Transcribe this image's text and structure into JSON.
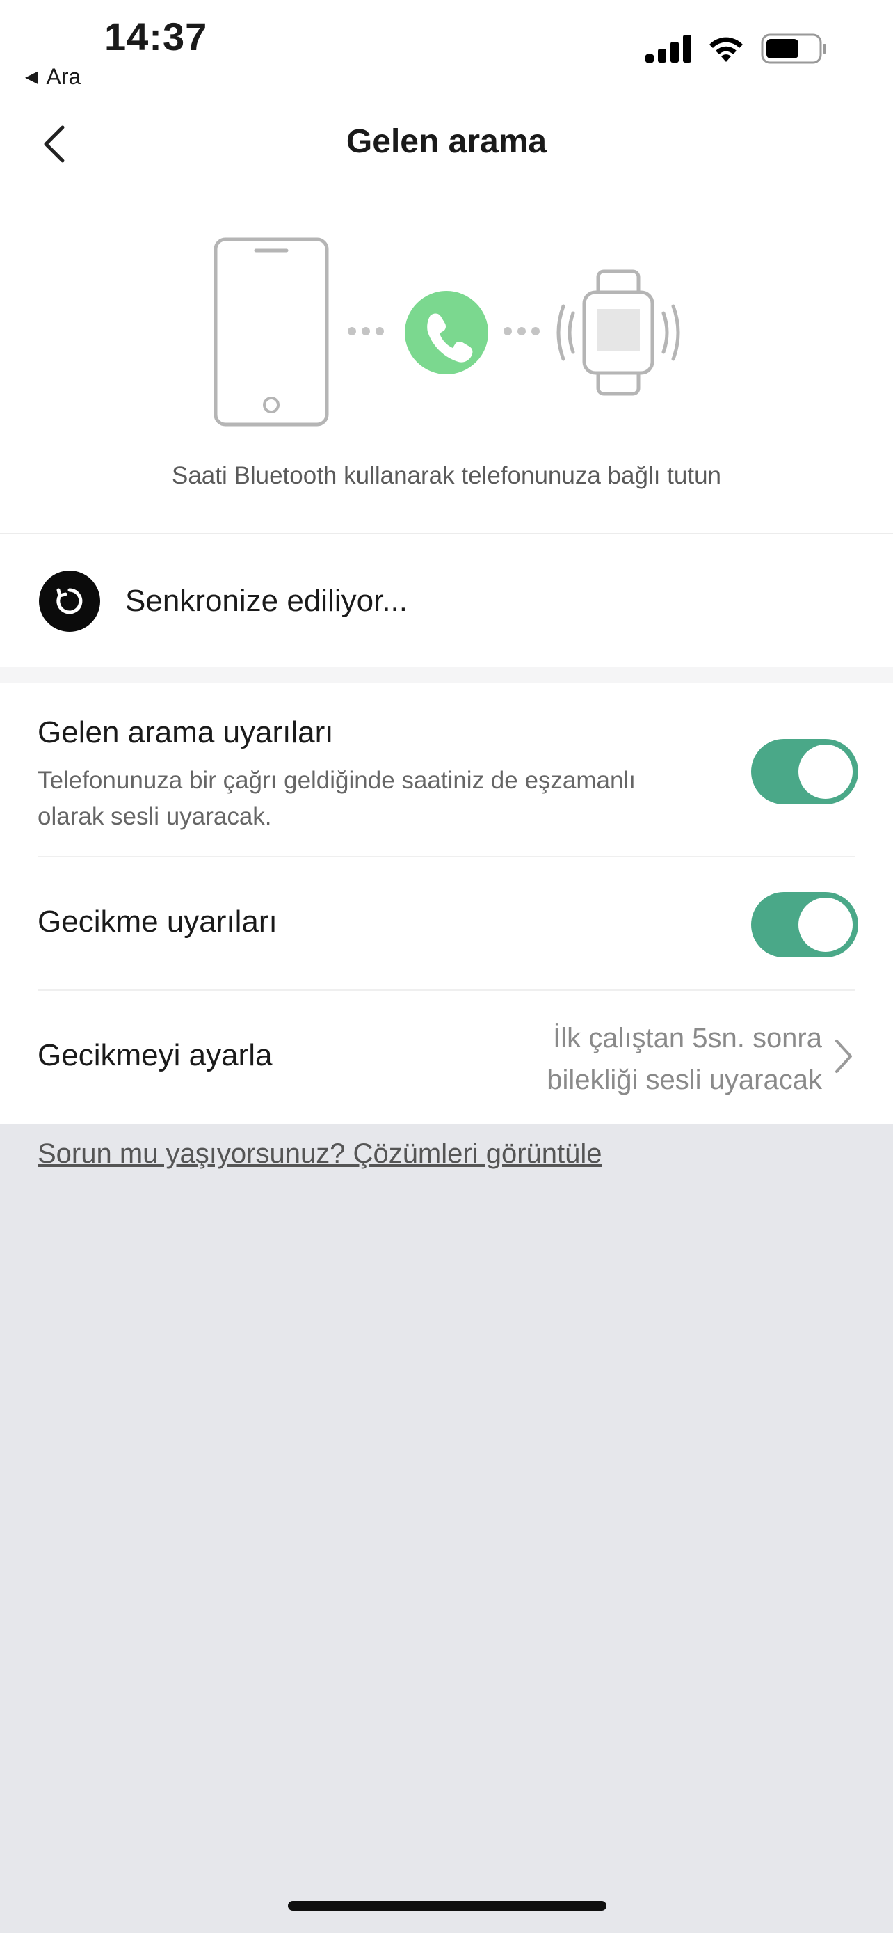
{
  "status_bar": {
    "time": "14:37",
    "back_app": "Ara",
    "icons": [
      "signal-icon",
      "wifi-icon",
      "battery-icon"
    ]
  },
  "nav": {
    "title": "Gelen arama",
    "back_icon": "chevron-left-icon"
  },
  "illustration": {
    "caption": "Saati Bluetooth kullanarak telefonunuza bağlı tutun",
    "icons": [
      "phone-outline-icon",
      "call-icon",
      "watch-vibrate-icon"
    ],
    "accent_color": "#7bd88f"
  },
  "sync": {
    "label": "Senkronize ediliyor...",
    "icon": "sync-icon"
  },
  "settings": {
    "incoming_alerts": {
      "title": "Gelen arama uyarıları",
      "description": "Telefonunuza bir çağrı geldiğinde saatiniz de eşzamanlı olarak sesli uyaracak.",
      "enabled": true
    },
    "delay_alerts": {
      "title": "Gecikme uyarıları",
      "enabled": true
    },
    "set_delay": {
      "title": "Gecikmeyi ayarla",
      "value_line1": "İlk çalıştan 5sn. sonra",
      "value_line2": "bilekliği sesli uyaracak"
    }
  },
  "help_link": "Sorun mu yaşıyorsunuz? Çözümleri görüntüle",
  "colors": {
    "toggle_on": "#4aa888",
    "call_green": "#7bd88f",
    "background": "#e6e7eb"
  }
}
